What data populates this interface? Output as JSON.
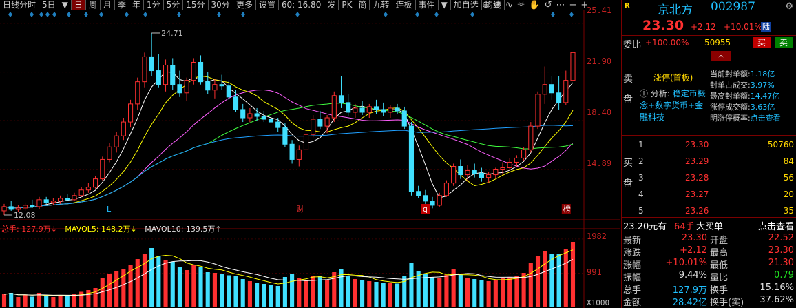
{
  "toolbar": {
    "items": [
      "日线分时",
      "5日",
      "▼",
      "日",
      "周",
      "月",
      "季",
      "年",
      "1分",
      "5分",
      "15分",
      "30分",
      "更多",
      "设置"
    ],
    "active_index": 3,
    "extra": [
      "60: 16.80",
      "发",
      "PK",
      "筒",
      "九转",
      "连板",
      "事件",
      "▼",
      "加自选",
      "均线"
    ],
    "icons": [
      "zoom-out-icon",
      "zoom-in-icon",
      "wave-icon",
      "brightness-icon",
      "hand-icon",
      "reset-icon",
      "more-icon",
      "minus-icon",
      "plus-icon"
    ]
  },
  "price_axis": [
    "25.41",
    "21.90",
    "18.40",
    "14.89"
  ],
  "price_marks": {
    "high_label": "24.71",
    "low_label": "12.08"
  },
  "event_markers": [
    "L",
    "财",
    "q",
    "榜"
  ],
  "volume_header": {
    "zongshou": "总手: 127.9万↓",
    "mavol5": "MAVOL5: 148.2万↓",
    "mavol10": "MAVOL10: 139.5万↑"
  },
  "volume_axis": [
    "1982",
    "991",
    "X1000"
  ],
  "colors": {
    "up": "#ff3030",
    "down": "#40e0ff",
    "ma5": "#ffffff",
    "ma10": "#ffff00",
    "ma20": "#ff60ff",
    "ma30": "#40ff40",
    "ma60": "#20a0ff"
  },
  "chart_data": {
    "type": "candlestick",
    "ylim": [
      11.5,
      26.0
    ],
    "candles": [
      [
        11.9,
        12.4,
        11.6,
        12.2
      ],
      [
        12.2,
        12.6,
        11.9,
        12.0
      ],
      [
        12.0,
        12.3,
        11.8,
        12.1
      ],
      [
        12.1,
        12.5,
        11.9,
        12.3
      ],
      [
        12.3,
        12.7,
        12.1,
        12.2
      ],
      [
        12.2,
        12.9,
        12.0,
        12.7
      ],
      [
        12.7,
        12.9,
        12.4,
        12.5
      ],
      [
        12.5,
        12.8,
        12.3,
        12.6
      ],
      [
        12.6,
        13.0,
        12.4,
        12.8
      ],
      [
        12.8,
        13.1,
        12.6,
        12.7
      ],
      [
        12.7,
        13.2,
        12.6,
        13.0
      ],
      [
        13.0,
        13.6,
        12.9,
        13.4
      ],
      [
        13.4,
        13.9,
        13.2,
        13.6
      ],
      [
        13.6,
        14.4,
        13.5,
        14.2
      ],
      [
        14.2,
        15.8,
        14.1,
        15.6
      ],
      [
        15.6,
        16.8,
        15.4,
        16.5
      ],
      [
        16.5,
        17.6,
        16.1,
        17.3
      ],
      [
        17.3,
        18.6,
        17.0,
        18.3
      ],
      [
        18.3,
        19.9,
        17.9,
        19.6
      ],
      [
        19.6,
        21.5,
        19.2,
        21.2
      ],
      [
        21.2,
        23.3,
        20.8,
        23.0
      ],
      [
        23.0,
        24.71,
        21.6,
        22.0
      ],
      [
        22.0,
        23.2,
        20.8,
        21.0
      ],
      [
        21.0,
        22.8,
        20.5,
        22.4
      ],
      [
        22.4,
        22.9,
        20.6,
        21.0
      ],
      [
        21.0,
        22.0,
        20.1,
        20.4
      ],
      [
        20.4,
        21.5,
        19.8,
        21.3
      ],
      [
        21.3,
        22.9,
        21.0,
        22.6
      ],
      [
        22.6,
        23.1,
        21.0,
        21.2
      ],
      [
        21.2,
        21.9,
        20.3,
        20.6
      ],
      [
        20.6,
        21.4,
        20.0,
        21.0
      ],
      [
        21.0,
        21.7,
        20.6,
        20.9
      ],
      [
        20.9,
        21.3,
        19.9,
        20.1
      ],
      [
        20.1,
        20.6,
        19.0,
        19.2
      ],
      [
        19.2,
        19.6,
        18.3,
        18.6
      ],
      [
        18.6,
        19.3,
        18.3,
        18.9
      ],
      [
        18.9,
        19.3,
        18.4,
        18.7
      ],
      [
        18.7,
        19.1,
        18.3,
        18.5
      ],
      [
        18.5,
        18.9,
        18.0,
        18.3
      ],
      [
        18.3,
        18.6,
        17.6,
        17.9
      ],
      [
        17.9,
        18.2,
        16.5,
        16.7
      ],
      [
        16.7,
        17.0,
        15.3,
        15.6
      ],
      [
        15.6,
        16.6,
        15.1,
        16.3
      ],
      [
        16.3,
        17.6,
        16.1,
        17.4
      ],
      [
        17.4,
        18.8,
        17.2,
        18.5
      ],
      [
        18.5,
        19.1,
        17.8,
        18.0
      ],
      [
        18.0,
        18.8,
        17.5,
        18.6
      ],
      [
        18.6,
        20.5,
        18.3,
        20.2
      ],
      [
        20.2,
        21.6,
        19.3,
        19.7
      ],
      [
        19.7,
        20.3,
        18.7,
        19.0
      ],
      [
        19.0,
        19.6,
        18.6,
        19.3
      ],
      [
        19.3,
        19.8,
        18.8,
        19.0
      ],
      [
        19.0,
        19.6,
        18.6,
        19.4
      ],
      [
        19.4,
        19.9,
        18.9,
        19.2
      ],
      [
        19.2,
        19.7,
        18.7,
        19.0
      ],
      [
        19.0,
        19.5,
        18.6,
        19.3
      ],
      [
        19.3,
        19.6,
        18.9,
        19.1
      ],
      [
        19.1,
        19.4,
        17.8,
        18.0
      ],
      [
        18.0,
        18.3,
        13.0,
        13.3
      ],
      [
        13.3,
        13.7,
        12.8,
        13.0
      ],
      [
        13.0,
        13.4,
        12.3,
        12.6
      ],
      [
        12.6,
        12.9,
        12.08,
        12.3
      ],
      [
        12.3,
        13.2,
        12.2,
        13.0
      ],
      [
        13.0,
        14.1,
        12.9,
        13.9
      ],
      [
        13.9,
        15.3,
        13.7,
        15.1
      ],
      [
        15.1,
        15.6,
        14.2,
        14.5
      ],
      [
        14.5,
        15.2,
        14.0,
        14.8
      ],
      [
        14.8,
        15.3,
        14.3,
        14.6
      ],
      [
        14.6,
        15.0,
        14.0,
        14.3
      ],
      [
        14.3,
        14.7,
        13.9,
        14.5
      ],
      [
        14.5,
        15.0,
        14.2,
        14.9
      ],
      [
        14.9,
        15.4,
        14.5,
        15.0
      ],
      [
        15.0,
        15.7,
        14.8,
        15.4
      ],
      [
        15.4,
        15.9,
        15.1,
        15.7
      ],
      [
        15.7,
        16.5,
        15.5,
        16.3
      ],
      [
        16.3,
        18.3,
        16.1,
        18.0
      ],
      [
        18.0,
        20.5,
        17.8,
        20.3
      ],
      [
        20.3,
        22.3,
        19.6,
        21.0
      ],
      [
        21.0,
        21.6,
        19.9,
        20.4
      ],
      [
        20.4,
        21.6,
        19.2,
        19.7
      ],
      [
        19.7,
        22.0,
        19.5,
        21.3
      ],
      [
        21.3,
        23.3,
        21.3,
        23.3
      ]
    ],
    "volumes": [
      380,
      420,
      300,
      360,
      310,
      420,
      330,
      300,
      360,
      330,
      390,
      450,
      500,
      560,
      860,
      980,
      1060,
      1120,
      1240,
      1400,
      1550,
      1720,
      1500,
      1380,
      1320,
      1160,
      1080,
      1240,
      1180,
      1020,
      1000,
      980,
      930,
      900,
      820,
      760,
      700,
      680,
      640,
      620,
      880,
      960,
      860,
      800,
      900,
      920,
      800,
      1020,
      1100,
      920,
      820,
      780,
      760,
      740,
      720,
      700,
      690,
      900,
      1300,
      1050,
      980,
      880,
      860,
      940,
      1100,
      960,
      860,
      820,
      780,
      760,
      800,
      840,
      880,
      920,
      1000,
      1300,
      1480,
      1620,
      1550,
      1560,
      1700,
      1900
    ],
    "ylim_volume": [
      0,
      2000
    ]
  },
  "right_panel": {
    "flag": "R",
    "name": "京北方",
    "code": "002987",
    "price": "23.30",
    "change": "+2.12",
    "pct": "+10.01%",
    "board": "陆",
    "weibi_label": "委比",
    "weibi_val": "+100.00%",
    "weibi_num": "50955",
    "buy": "买",
    "sell": "卖",
    "sell_side": "卖盘",
    "buy_side": "买盘",
    "zt_title": "涨停(首板)",
    "analysis_prefix": "分析:",
    "analysis_text": "稳定币概念+数字货币+金融科技",
    "stats": [
      [
        "当前封单额:",
        "1.18亿"
      ],
      [
        "封单占成交:",
        "3.97%"
      ],
      [
        "最高封单额:",
        "14.47亿"
      ],
      [
        "涨停成交额:",
        "3.63亿"
      ],
      [
        "明涨停概率:",
        "点击查看"
      ]
    ],
    "bids": [
      [
        "1",
        "23.30",
        "50760"
      ],
      [
        "2",
        "23.29",
        "84"
      ],
      [
        "3",
        "23.28",
        "56"
      ],
      [
        "4",
        "23.27",
        "20"
      ],
      [
        "5",
        "23.26",
        "35"
      ]
    ],
    "deal": {
      "price": "23.20元有",
      "lots": "64手",
      "type": "大买单",
      "link": "点击查看"
    },
    "quote": [
      [
        "最新",
        "23.30",
        "red",
        "开盘",
        "22.52",
        "red"
      ],
      [
        "涨跌",
        "+2.12",
        "red",
        "最高",
        "23.30",
        "red"
      ],
      [
        "涨幅",
        "+10.01%",
        "red",
        "最低",
        "21.30",
        "red"
      ],
      [
        "振幅",
        "9.44%",
        "white",
        "量比",
        "0.79",
        "green"
      ],
      [
        "总手",
        "127.9万",
        "cyan",
        "换手",
        "15.16%",
        "white"
      ],
      [
        "金额",
        "28.42亿",
        "cyan",
        "换手(实)",
        "37.62%",
        "white"
      ]
    ]
  }
}
